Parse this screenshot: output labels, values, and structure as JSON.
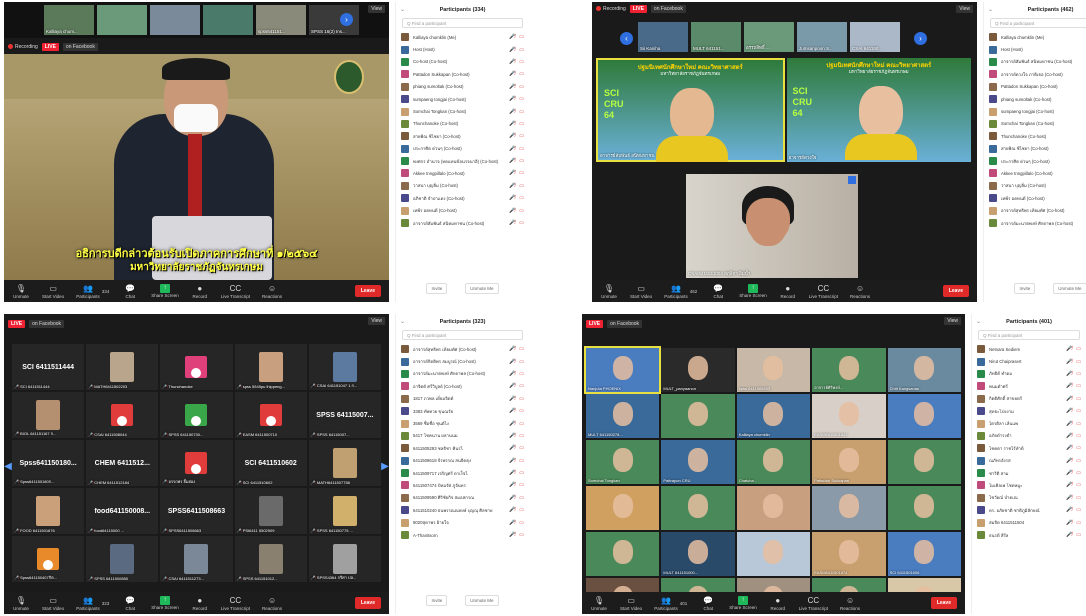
{
  "common": {
    "recording": "Recording",
    "live": "LIVE",
    "facebook": "on Facebook",
    "view": "View",
    "search_placeholder": "Q Find a participant",
    "invite": "Invite",
    "unmute_me": "Unmute Me",
    "leave": "Leave",
    "toolbar": [
      "Unmute",
      "Start Video",
      "Participants",
      "Chat",
      "Share Screen",
      "Record",
      "Live Transcript",
      "Reactions"
    ]
  },
  "q0": {
    "title": "Participants (334)",
    "strip": [
      "Kalliaya chum...",
      "",
      "",
      "",
      "spss641151...",
      "SPSS 16(2) Ins..."
    ],
    "caption1": "อธิการบดีกล่าวต้อนรับเปิดภาคการศึกษาที่ ๑/๒๕๖๔",
    "caption2": "มหาวิทยาลัยราชภัฏจันทรเกษม",
    "count": "334",
    "participants": [
      "Kalliaya chumklin (Me)",
      "Host (Host)",
      "Co-host (Co-host)",
      "Pattadon Sukkapan (Co-host)",
      "phiang sumoltak (Co-host)",
      "sumpaeng tongjai (Co-host)",
      "Somchai Tongkan (Co-host)",
      "Thunchanoke (Co-host)",
      "สายพิณ ชีไชยา (Co-host)",
      "ประกาศิต ด่วนๆ (Co-host)",
      "พงศกร อำนาจ (ทดแทนข้อนรจนาอิ) (Co-host)",
      "Akkee tnngpillalo (Co-host)",
      "วาสนา บุญลิ่ม (Co-host)",
      "อภิชาติ จำปาแดง (Co-host)",
      "เทพีร อดทนดี (Co-host)",
      "อาจารย์สัมพันธ์ สนิทมหาชน (Co-host)"
    ]
  },
  "q1": {
    "title": "Participants (462)",
    "strip": [
      "Sii Kaniha",
      "MULT 641151...",
      "อรรถสิทธิ์ ...",
      "Jumsanpoon S...",
      "CSAI 641150..."
    ],
    "banner_line1": "ปฐมนิเทศนักศึกษาใหม่ คณะวิทยาศาสตร์",
    "banner_line2": "มหาวิทยาลัยราชภัฏจันทรเกษม",
    "logo": "SCI CRU 64",
    "v1": "อาจารย์สัมพันธ์ สนิทมหาชน",
    "v2": "อาจารย์ดวงใจ",
    "v3": "CSAI6411511004 สภุสิกา อิ่มน้ำ",
    "count": "462",
    "participants": [
      "Kalliaya chumklin (Me)",
      "Host (Host)",
      "อาจารย์สัมพันธ์ สนิทมหาชน (Co-host)",
      "อาจารย์ดวงใจ ภาดิเธอ (Co-host)",
      "Pattadon Sukkapan (Co-host)",
      "phiang sumoltak (Co-host)",
      "sumpaeng tongjai (Co-host)",
      "Somchai Tongkan (Co-host)",
      "Thunchanoke (Co-host)",
      "สายพิณ ชีไชยา (Co-host)",
      "ประกาศิต ด่วนๆ (Co-host)",
      "Akkee tnngpillalo (Co-host)",
      "วาสนา บุญลิ่ม (Co-host)",
      "เทพีร อดทนดี (Co-host)",
      "อาจารย์สุทธิพร เทียมทัศ (Co-host)",
      "อาจารย์มะนาตพงษ์ ศักดาพล (Co-host)"
    ]
  },
  "q2": {
    "title": "Participants (323)",
    "count": "323",
    "cells": [
      {
        "big": "SCI 6411511444",
        "name": "SCI 6411511444",
        "kind": "text"
      },
      {
        "big": "",
        "name": "MATH6411502203",
        "kind": "photo",
        "color": "#b9a48c"
      },
      {
        "big": "",
        "name": "Thunchanoke",
        "kind": "avatar",
        "color": "#e0407a"
      },
      {
        "big": "",
        "name": "spss 5545pu lhippeng...",
        "kind": "photo",
        "color": "#c8a080"
      },
      {
        "big": "",
        "name": "CSAI 641151047 1 ก...",
        "kind": "photo",
        "color": "#5c7aa0"
      },
      {
        "big": "",
        "name": "BIOL 641151167 ก...",
        "kind": "photo",
        "color": "#b49070"
      },
      {
        "big": "",
        "name": "CSAI 6411508044",
        "kind": "avatar",
        "color": "#e03c3c"
      },
      {
        "big": "",
        "name": "SPSS 641150730...",
        "kind": "avatar",
        "color": "#3aa64a"
      },
      {
        "big": "",
        "name": "EASM 6411500710",
        "kind": "avatar",
        "color": "#e03c3c"
      },
      {
        "big": "SPSS 64115007...",
        "name": "SPSS 64115007...",
        "kind": "text"
      },
      {
        "big": "Spss641150180...",
        "name": "Spss641150180ก...",
        "kind": "text"
      },
      {
        "big": "CHEM 6411512...",
        "name": "CHEM 6411512184",
        "kind": "text"
      },
      {
        "big": "",
        "name": "อรรถพร ยิ้มย่อง",
        "kind": "avatar",
        "color": "#e03c3c"
      },
      {
        "big": "SCI 6411510602",
        "name": "SCI 6411510602",
        "kind": "text"
      },
      {
        "big": "",
        "name": "MATH6411507758",
        "kind": "photo",
        "color": "#c0a070"
      },
      {
        "big": "",
        "name": "FOOD 6411501676",
        "kind": "photo",
        "color": "#caa07a"
      },
      {
        "big": "food641150008...",
        "name": "food64115000 ...",
        "kind": "text"
      },
      {
        "big": "SPSS6411508663",
        "name": "SPSS6411508663",
        "kind": "text"
      },
      {
        "big": "",
        "name": "PSI6411 5502909",
        "kind": "photo",
        "color": "#6a6a6a"
      },
      {
        "big": "",
        "name": "SPSS 641150775 ...",
        "kind": "photo",
        "color": "#d0b06a"
      },
      {
        "big": "",
        "name": "Spss641150407กิต...",
        "kind": "avatar",
        "color": "#e88a2a"
      },
      {
        "big": "",
        "name": "SPSS 6411500850",
        "kind": "photo",
        "color": "#5a6a80"
      },
      {
        "big": "",
        "name": "CSAI 6411511273...",
        "kind": "photo",
        "color": "#7a8898"
      },
      {
        "big": "",
        "name": "SPSS 641151012...",
        "kind": "photo",
        "color": "#8a8070"
      },
      {
        "big": "",
        "name": "SPSS4364 กรีศา ปล...",
        "kind": "photo",
        "color": "#a0a0a0"
      }
    ],
    "participants": [
      "อาจารย์สุทธิพร เทียมทัศ (Co-host)",
      "อาจารย์กิตติพร สมบูรณ์ (Co-host)",
      "อาจารย์มะนาตพงษ์ ศักดาพล (Co-host)",
      "อาจิตต์ ศรีวิบูลย์ (Co-host)",
      "1817 ภวพล เดี่ยมจิตต์",
      "3383 ทัพทวย ขุนณรัย",
      "3569 ชื่อชื่อ ชุนต์ไง",
      "5417 โชคนาน ผลานนม",
      "6411505293 ชลธิชา คินรไ",
      "6411508618 จีรพรรณ สนธิดตุง",
      "6411509717 เจริญศรี ดาเร็จไ",
      "6411507474 ปัทมรัศ ภูจันทร",
      "6411509590 ศิริชัยกิจ สมอสกรณ",
      "6411510240 ธนพรรณณพงษ์ บุญณุ ศิลชาย",
      "9020สุดาพร ฝ้ายใจ",
      "A-Thanitsorn"
    ]
  },
  "q3": {
    "title": "Participants (401)",
    "count": "401",
    "cells": [
      {
        "name": "Nanjuta PHOENIX",
        "color": "#4a7cc0",
        "sel": true
      },
      {
        "name": "MULT_panyaanon",
        "color": "#2a2a2a"
      },
      {
        "name": "spss 6411505893",
        "color": "#c8b8a8"
      },
      {
        "name": "อาจารย์ศิริพงษ์...",
        "color": "#4a8a5a"
      },
      {
        "name": "Chitt Kangsanan",
        "color": "#6a8aa0"
      },
      {
        "name": "MULT 641150278...",
        "color": "#3a6a9a"
      },
      {
        "name": "",
        "color": "#4a8a5a"
      },
      {
        "name": "Kalliaya chumklin",
        "color": "#3a6a9a"
      },
      {
        "name": "EASM6411501842",
        "color": "#d8d0c8"
      },
      {
        "name": "",
        "color": "#4a7cc0"
      },
      {
        "name": "Somchai Tongkan",
        "color": "#4a8a5a"
      },
      {
        "name": "Pattrapon CRU",
        "color": "#3a6a9a"
      },
      {
        "name": "Chatcha...",
        "color": "#4a8a5a"
      },
      {
        "name": "Pattadon Sukkapan",
        "color": "#c8a070"
      },
      {
        "name": "",
        "color": "#4a8a5a"
      },
      {
        "name": "",
        "color": "#d0a060"
      },
      {
        "name": "",
        "color": "#4a8a5a"
      },
      {
        "name": "",
        "color": "#c8a080"
      },
      {
        "name": "",
        "color": "#8a9aa8"
      },
      {
        "name": "",
        "color": "#4a8a5a"
      },
      {
        "name": "",
        "color": "#4a8a5a"
      },
      {
        "name": "MULT 641151000...",
        "color": "#2a4a6a"
      },
      {
        "name": "",
        "color": "#b8c8d8"
      },
      {
        "name": "EASM6411501874",
        "color": "#c8a070"
      },
      {
        "name": "SCI 6411501606",
        "color": "#4a7cc0"
      },
      {
        "name": "CSAI 641150904",
        "color": "#6a5040"
      },
      {
        "name": "Sii Kaniha",
        "color": "#4a8a5a"
      },
      {
        "name": "MULT 6411507921",
        "color": "#a09080"
      },
      {
        "name": "ผศ.ดร.ทวีศักดิ์ ...",
        "color": "#4a8a5a"
      },
      {
        "name": "",
        "color": "#d8c8a8"
      }
    ],
    "participants": [
      "Netnara Sediem",
      "Nirut Chaiprasert",
      "ภัทธิดี ทำดม",
      "พนมดำศรี",
      "กิตติศักดิ์ สาขยตรี",
      "สุทธะโป่งงาม",
      "ไตรดิลา เล้นแพ",
      "อภัยดำรงธำ",
      "โชคตา ราชไร้ทำดี",
      "ณภัทรอังรส",
      "ชาริติ สาม",
      "ไมเคิลเพ โชดหมูะ",
      "โชวัยณ์ บำดเณ",
      "ดร. อภัยชาติ ชาติภูมิลักษณ์",
      "สมจิต 6411511504",
      "ธนรดี สีรีล"
    ]
  }
}
